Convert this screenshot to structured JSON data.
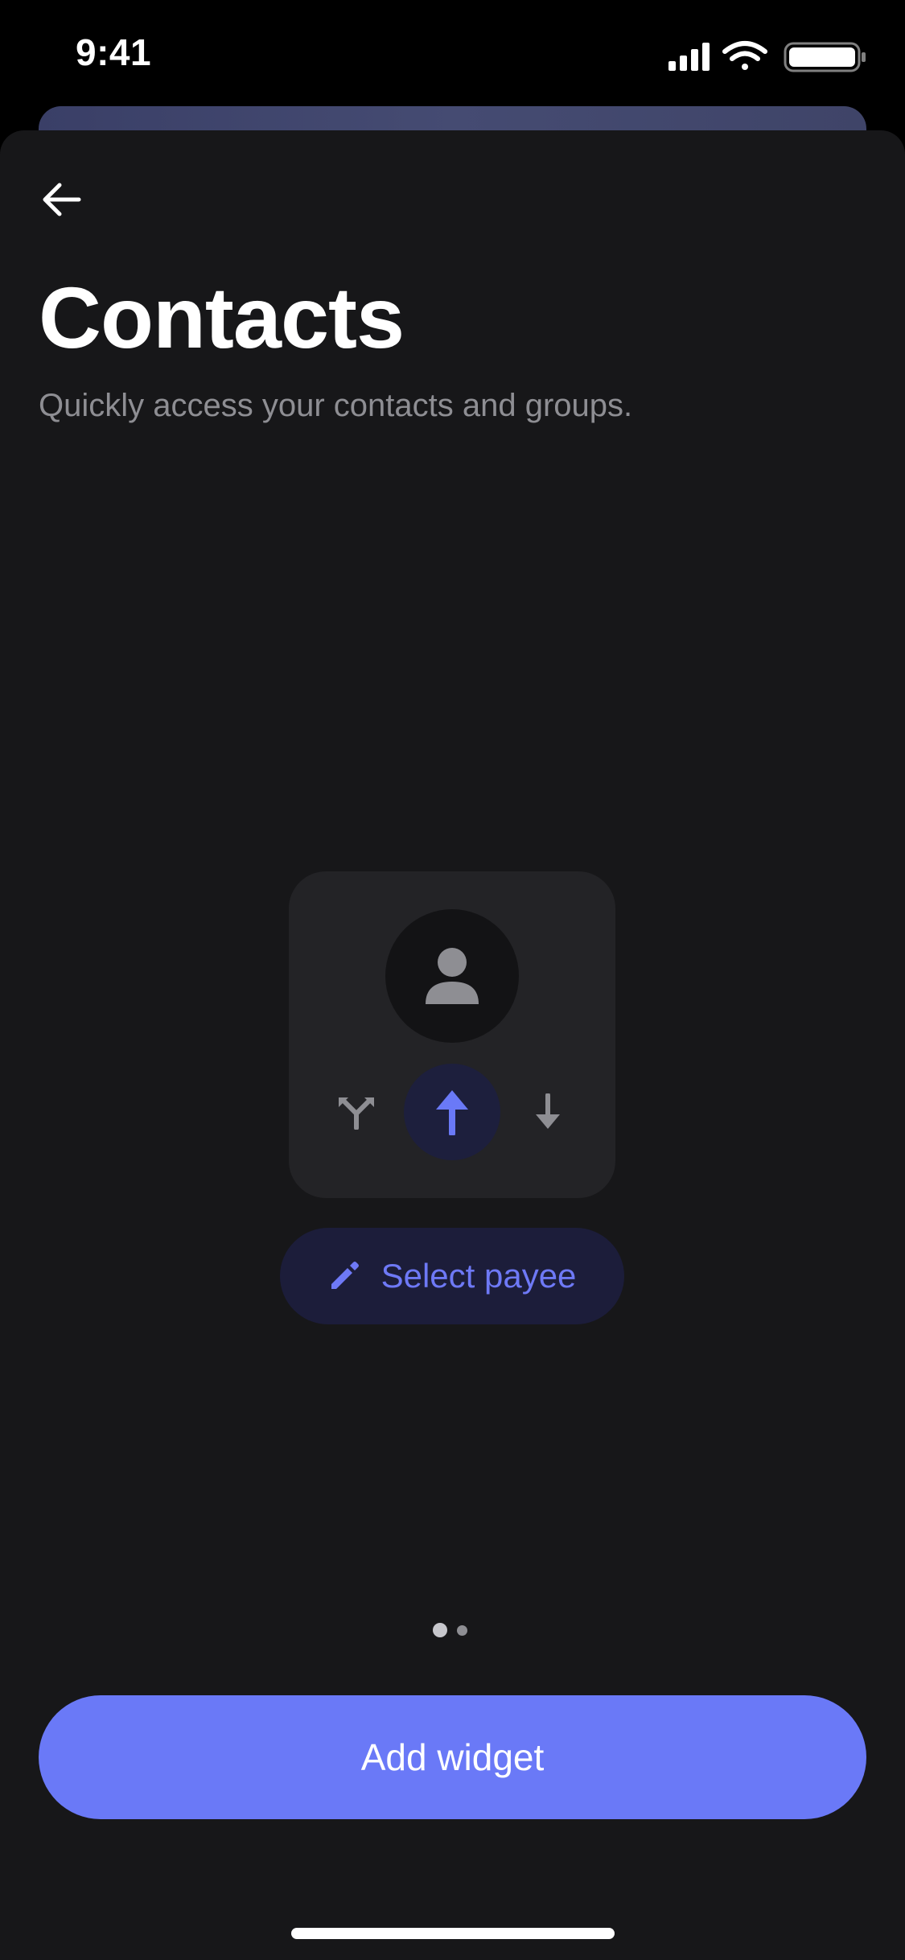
{
  "status_bar": {
    "time": "9:41",
    "signal_icon": "cellular-signal-icon",
    "wifi_icon": "wifi-icon",
    "battery_icon": "battery-icon"
  },
  "header": {
    "back_icon": "arrow-left-icon",
    "title": "Contacts",
    "subtitle": "Quickly access your contacts and groups."
  },
  "widget_preview": {
    "avatar_icon": "person-icon",
    "actions": [
      {
        "icon": "split-icon"
      },
      {
        "icon": "arrow-up-icon",
        "selected": true
      },
      {
        "icon": "arrow-down-icon"
      }
    ]
  },
  "select_payee": {
    "icon": "pencil-icon",
    "label": "Select payee"
  },
  "pager": {
    "total": 2,
    "current": 1
  },
  "add_widget": {
    "label": "Add widget"
  },
  "colors": {
    "accent": "#6a79f7",
    "accent_text": "#6e79f6",
    "sheet_background": "#171719",
    "card_background": "#232326",
    "subtitle": "#8e8e93"
  }
}
